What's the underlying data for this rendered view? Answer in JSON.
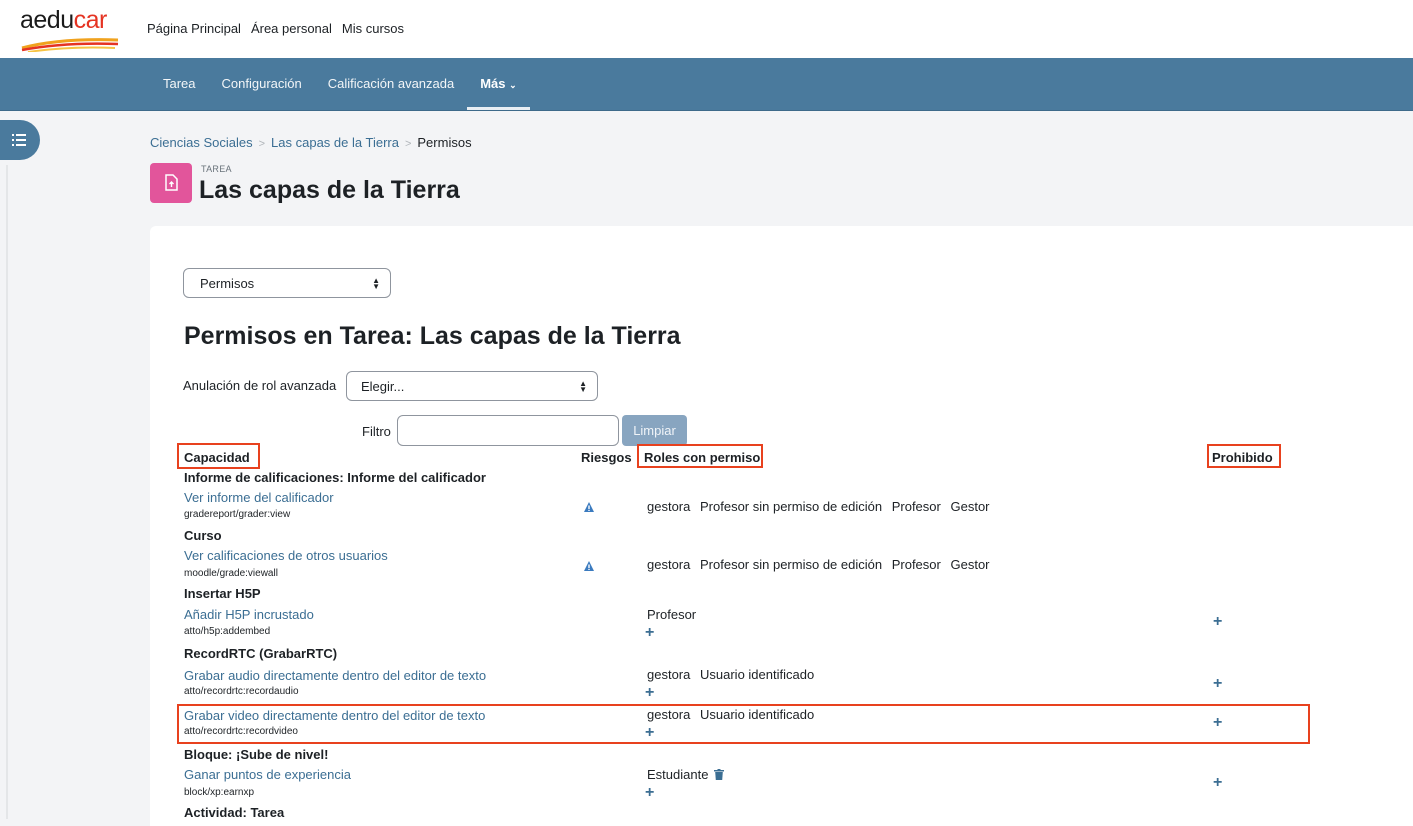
{
  "brand": {
    "logo_main": "aedu",
    "logo_accent": "car"
  },
  "top_nav": [
    "Página Principal",
    "Área personal",
    "Mis cursos"
  ],
  "secondary_nav": {
    "items": [
      "Tarea",
      "Configuración",
      "Calificación avanzada"
    ],
    "more": "Más"
  },
  "breadcrumb": {
    "items": [
      "Ciencias Sociales",
      "Las capas de la Tierra"
    ],
    "current": "Permisos"
  },
  "header": {
    "type": "TAREA",
    "title": "Las capas de la Tierra"
  },
  "page": {
    "perm_select": "Permisos",
    "heading": "Permisos en Tarea: Las capas de la Tierra",
    "advanced_label": "Anulación de rol avanzada",
    "advanced_select": "Elegir...",
    "filter_label": "Filtro",
    "filter_value": "",
    "clear_button": "Limpiar"
  },
  "table": {
    "headers": {
      "capability": "Capacidad",
      "risks": "Riesgos",
      "roles": "Roles con permiso",
      "prohibited": "Prohibido"
    },
    "groups": [
      "Informe de calificaciones: Informe del calificador",
      "Curso",
      "Insertar H5P",
      "RecordRTC (GrabarRTC)",
      "Bloque: ¡Sube de nivel!",
      "Actividad: Tarea"
    ],
    "rows": [
      {
        "name": "Ver informe del calificador",
        "code": "gradereport/grader:view",
        "roles": [
          "gestora",
          "Profesor sin permiso de edición",
          "Profesor",
          "Gestor"
        ]
      },
      {
        "name": "Ver calificaciones de otros usuarios",
        "code": "moodle/grade:viewall",
        "roles": [
          "gestora",
          "Profesor sin permiso de edición",
          "Profesor",
          "Gestor"
        ]
      },
      {
        "name": "Añadir H5P incrustado",
        "code": "atto/h5p:addembed",
        "roles": [
          "Profesor"
        ]
      },
      {
        "name": "Grabar audio directamente dentro del editor de texto",
        "code": "atto/recordrtc:recordaudio",
        "roles": [
          "gestora",
          "Usuario identificado"
        ]
      },
      {
        "name": "Grabar video directamente dentro del editor de texto",
        "code": "atto/recordrtc:recordvideo",
        "roles": [
          "gestora",
          "Usuario identificado"
        ]
      },
      {
        "name": "Ganar puntos de experiencia",
        "code": "block/xp:earnxp",
        "roles": [
          "Estudiante"
        ]
      }
    ]
  },
  "colors": {
    "nav": "#4a7a9d",
    "link": "#3b6e93",
    "highlight": "#e8411e",
    "module_icon": "#e2559b"
  }
}
